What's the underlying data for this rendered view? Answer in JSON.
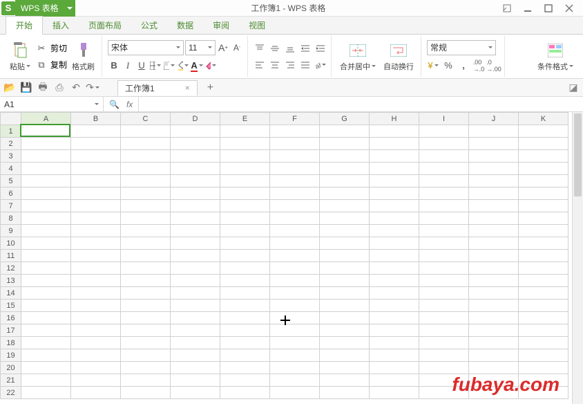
{
  "app": {
    "logo_letter": "S",
    "name": "WPS 表格",
    "doc_title": "工作簿1 - WPS 表格"
  },
  "tabs": {
    "items": [
      "开始",
      "插入",
      "页面布局",
      "公式",
      "数据",
      "审阅",
      "视图"
    ],
    "active_index": 0
  },
  "ribbon": {
    "paste": "粘贴",
    "cut": "剪切",
    "copy": "复制",
    "format_painter": "格式刷",
    "font_name": "宋体",
    "font_size": "11",
    "merge_center": "合并居中",
    "wrap_text": "自动换行",
    "number_format": "常规",
    "cond_format": "条件格式"
  },
  "quickbar": {
    "sheet_tab": "工作簿1"
  },
  "formula": {
    "cell_ref": "A1",
    "fx_label": "fx",
    "value": ""
  },
  "grid": {
    "columns": [
      "A",
      "B",
      "C",
      "D",
      "E",
      "F",
      "G",
      "H",
      "I",
      "J",
      "K"
    ],
    "rows": [
      1,
      2,
      3,
      4,
      5,
      6,
      7,
      8,
      9,
      10,
      11,
      12,
      13,
      14,
      15,
      16,
      17,
      18,
      19,
      20,
      21,
      22
    ],
    "active": {
      "row": 1,
      "col": "A"
    }
  },
  "watermark": "fubaya.com"
}
